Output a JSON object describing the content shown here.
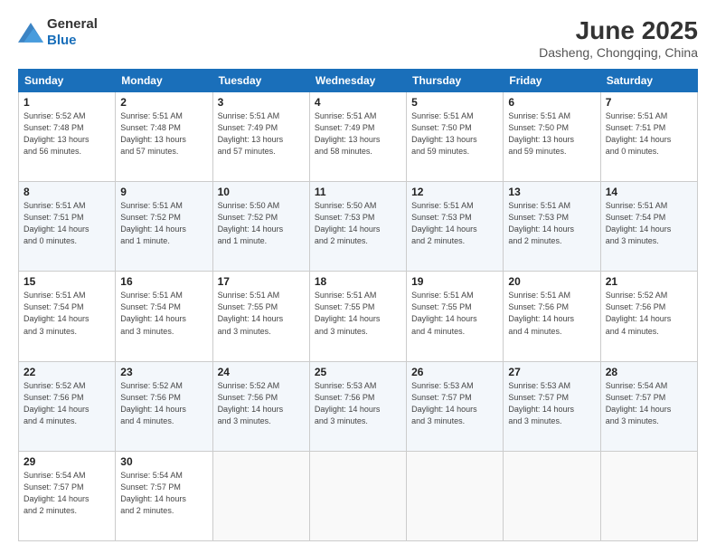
{
  "header": {
    "logo_general": "General",
    "logo_blue": "Blue",
    "month_year": "June 2025",
    "location": "Dasheng, Chongqing, China"
  },
  "weekdays": [
    "Sunday",
    "Monday",
    "Tuesday",
    "Wednesday",
    "Thursday",
    "Friday",
    "Saturday"
  ],
  "weeks": [
    [
      {
        "day": "1",
        "info": "Sunrise: 5:52 AM\nSunset: 7:48 PM\nDaylight: 13 hours\nand 56 minutes."
      },
      {
        "day": "2",
        "info": "Sunrise: 5:51 AM\nSunset: 7:48 PM\nDaylight: 13 hours\nand 57 minutes."
      },
      {
        "day": "3",
        "info": "Sunrise: 5:51 AM\nSunset: 7:49 PM\nDaylight: 13 hours\nand 57 minutes."
      },
      {
        "day": "4",
        "info": "Sunrise: 5:51 AM\nSunset: 7:49 PM\nDaylight: 13 hours\nand 58 minutes."
      },
      {
        "day": "5",
        "info": "Sunrise: 5:51 AM\nSunset: 7:50 PM\nDaylight: 13 hours\nand 59 minutes."
      },
      {
        "day": "6",
        "info": "Sunrise: 5:51 AM\nSunset: 7:50 PM\nDaylight: 13 hours\nand 59 minutes."
      },
      {
        "day": "7",
        "info": "Sunrise: 5:51 AM\nSunset: 7:51 PM\nDaylight: 14 hours\nand 0 minutes."
      }
    ],
    [
      {
        "day": "8",
        "info": "Sunrise: 5:51 AM\nSunset: 7:51 PM\nDaylight: 14 hours\nand 0 minutes."
      },
      {
        "day": "9",
        "info": "Sunrise: 5:51 AM\nSunset: 7:52 PM\nDaylight: 14 hours\nand 1 minute."
      },
      {
        "day": "10",
        "info": "Sunrise: 5:50 AM\nSunset: 7:52 PM\nDaylight: 14 hours\nand 1 minute."
      },
      {
        "day": "11",
        "info": "Sunrise: 5:50 AM\nSunset: 7:53 PM\nDaylight: 14 hours\nand 2 minutes."
      },
      {
        "day": "12",
        "info": "Sunrise: 5:51 AM\nSunset: 7:53 PM\nDaylight: 14 hours\nand 2 minutes."
      },
      {
        "day": "13",
        "info": "Sunrise: 5:51 AM\nSunset: 7:53 PM\nDaylight: 14 hours\nand 2 minutes."
      },
      {
        "day": "14",
        "info": "Sunrise: 5:51 AM\nSunset: 7:54 PM\nDaylight: 14 hours\nand 3 minutes."
      }
    ],
    [
      {
        "day": "15",
        "info": "Sunrise: 5:51 AM\nSunset: 7:54 PM\nDaylight: 14 hours\nand 3 minutes."
      },
      {
        "day": "16",
        "info": "Sunrise: 5:51 AM\nSunset: 7:54 PM\nDaylight: 14 hours\nand 3 minutes."
      },
      {
        "day": "17",
        "info": "Sunrise: 5:51 AM\nSunset: 7:55 PM\nDaylight: 14 hours\nand 3 minutes."
      },
      {
        "day": "18",
        "info": "Sunrise: 5:51 AM\nSunset: 7:55 PM\nDaylight: 14 hours\nand 3 minutes."
      },
      {
        "day": "19",
        "info": "Sunrise: 5:51 AM\nSunset: 7:55 PM\nDaylight: 14 hours\nand 4 minutes."
      },
      {
        "day": "20",
        "info": "Sunrise: 5:51 AM\nSunset: 7:56 PM\nDaylight: 14 hours\nand 4 minutes."
      },
      {
        "day": "21",
        "info": "Sunrise: 5:52 AM\nSunset: 7:56 PM\nDaylight: 14 hours\nand 4 minutes."
      }
    ],
    [
      {
        "day": "22",
        "info": "Sunrise: 5:52 AM\nSunset: 7:56 PM\nDaylight: 14 hours\nand 4 minutes."
      },
      {
        "day": "23",
        "info": "Sunrise: 5:52 AM\nSunset: 7:56 PM\nDaylight: 14 hours\nand 4 minutes."
      },
      {
        "day": "24",
        "info": "Sunrise: 5:52 AM\nSunset: 7:56 PM\nDaylight: 14 hours\nand 3 minutes."
      },
      {
        "day": "25",
        "info": "Sunrise: 5:53 AM\nSunset: 7:56 PM\nDaylight: 14 hours\nand 3 minutes."
      },
      {
        "day": "26",
        "info": "Sunrise: 5:53 AM\nSunset: 7:57 PM\nDaylight: 14 hours\nand 3 minutes."
      },
      {
        "day": "27",
        "info": "Sunrise: 5:53 AM\nSunset: 7:57 PM\nDaylight: 14 hours\nand 3 minutes."
      },
      {
        "day": "28",
        "info": "Sunrise: 5:54 AM\nSunset: 7:57 PM\nDaylight: 14 hours\nand 3 minutes."
      }
    ],
    [
      {
        "day": "29",
        "info": "Sunrise: 5:54 AM\nSunset: 7:57 PM\nDaylight: 14 hours\nand 2 minutes."
      },
      {
        "day": "30",
        "info": "Sunrise: 5:54 AM\nSunset: 7:57 PM\nDaylight: 14 hours\nand 2 minutes."
      },
      null,
      null,
      null,
      null,
      null
    ]
  ]
}
